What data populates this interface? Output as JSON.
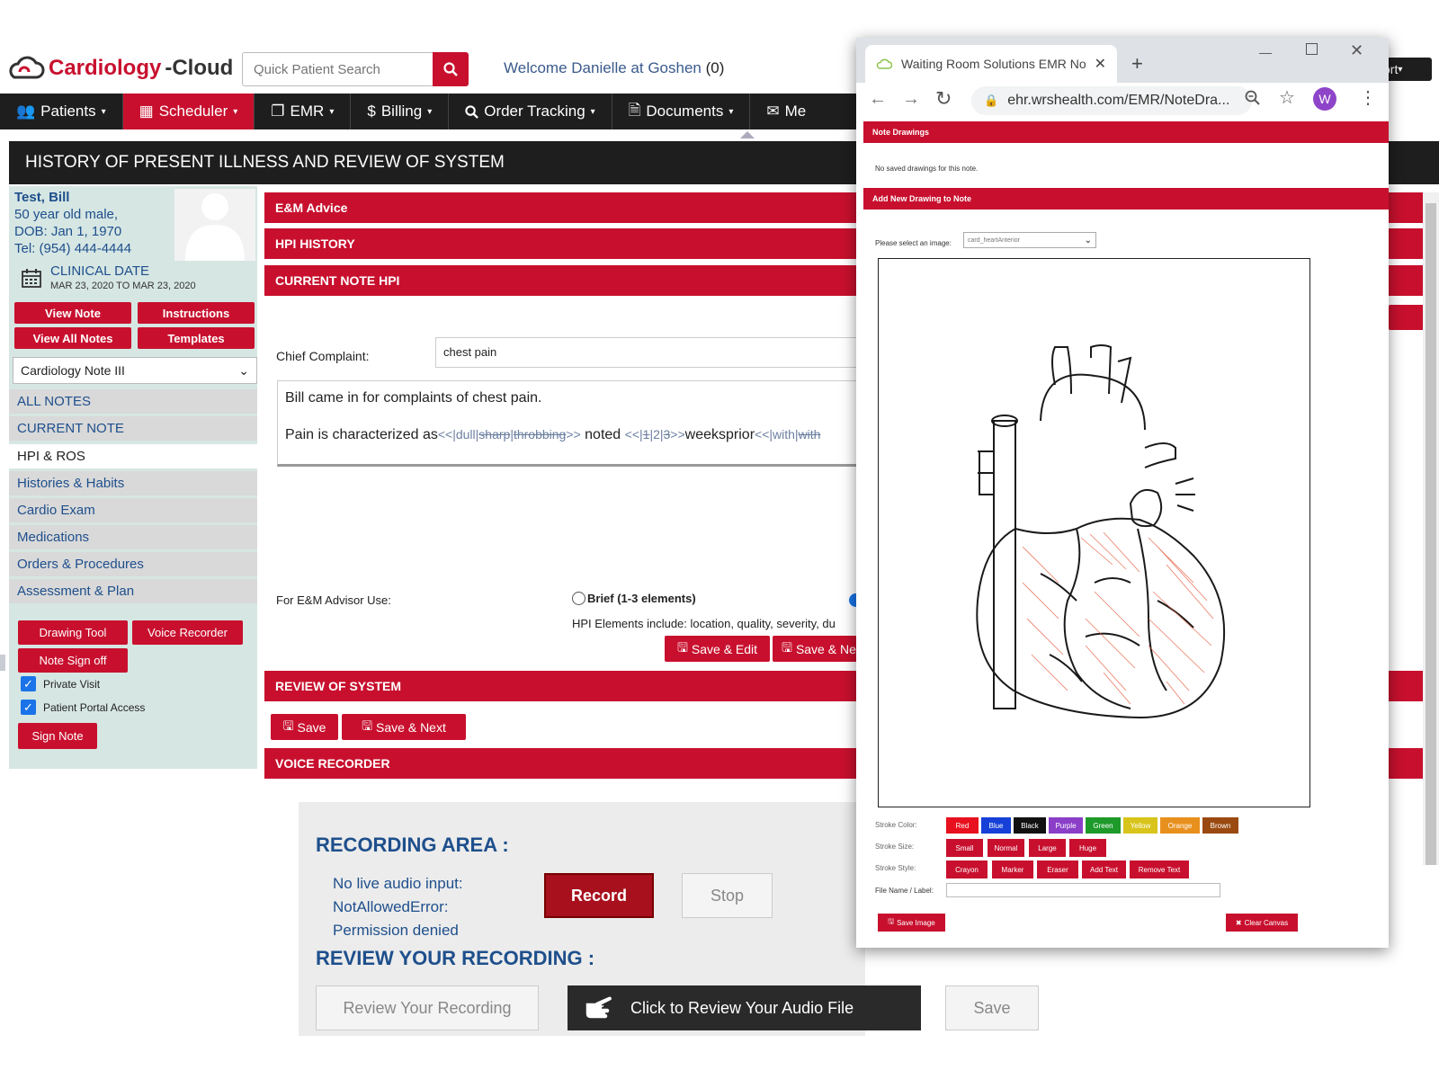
{
  "header": {
    "brand_part1": "Cardiology",
    "brand_part2": "-Cloud",
    "search_placeholder": "Quick Patient Search",
    "welcome": "Welcome Danielle at Goshen",
    "welcome_count": "(0)",
    "right_menu_fragment": "ort"
  },
  "nav": {
    "items": [
      {
        "label": "Patients"
      },
      {
        "label": "Scheduler"
      },
      {
        "label": "EMR"
      },
      {
        "label": "Billing"
      },
      {
        "label": "Order Tracking"
      },
      {
        "label": "Documents"
      },
      {
        "label": "Me"
      }
    ]
  },
  "page_title": "HISTORY OF PRESENT ILLNESS AND REVIEW OF SYSTEM",
  "patient": {
    "name": "Test, Bill",
    "age_sex": "50 year old male,",
    "dob": "DOB: Jan 1, 1970",
    "tel": "Tel: (954) 444-4444",
    "clinical_date_label": "CLINICAL DATE",
    "clinical_date_range": "MAR 23, 2020 TO MAR 23, 2020"
  },
  "sidebar": {
    "buttons": [
      "View Note",
      "Instructions",
      "View All Notes",
      "Templates"
    ],
    "note_template": "Cardiology Note III",
    "links": [
      "ALL NOTES",
      "CURRENT NOTE",
      "HPI & ROS",
      "Histories & Habits",
      "Cardio Exam",
      "Medications",
      "Orders & Procedures",
      "Assessment & Plan"
    ],
    "tool_buttons": [
      "Drawing Tool",
      "Voice Recorder",
      "Note Sign off"
    ],
    "checks": [
      "Private Visit",
      "Patient Portal Access"
    ],
    "sign_note": "Sign Note"
  },
  "main": {
    "em_advice": "E&M Advice",
    "hpi_history": "HPI HISTORY",
    "current_note_hpi": "CURRENT NOTE HPI",
    "chief_complaint_label": "Chief Complaint:",
    "chief_complaint_value": "chest pain",
    "hpi_line1": "Bill came in for complaints of chest pain.",
    "hpi_line2_prefix": "Pain is characterized as",
    "hpi_opt1": "<<|dull|",
    "hpi_opt1_strike1": "sharp",
    "hpi_opt1_sep": "|",
    "hpi_opt1_strike2": "throbbing",
    "hpi_opt1_end": ">>",
    "hpi_mid": " noted ",
    "hpi_opt2a": "<<|",
    "hpi_opt2_strike": "1",
    "hpi_opt2b": "|2|",
    "hpi_opt2_strike2": "3",
    "hpi_opt2c": ">>",
    "hpi_weeks": "weeksprior",
    "hpi_opt3": "<<|with|",
    "hpi_opt3_strike": "with",
    "em_use_label": "For E&M Advisor Use:",
    "brief_label": "Brief (1-3 elements)",
    "hpi_elements": "HPI Elements include: location, quality, severity, du",
    "save_edit": "Save & Edit",
    "save_next_partial": "Save & Ne",
    "review_of_system": "REVIEW OF SYSTEM",
    "save": "Save",
    "save_next": "Save & Next",
    "voice_recorder": "VOICE RECORDER"
  },
  "recording": {
    "area_title": "RECORDING AREA :",
    "msg1": "No live audio input:",
    "msg2": "NotAllowedError:",
    "msg3": "Permission denied",
    "record": "Record",
    "stop": "Stop",
    "review_title": "REVIEW YOUR RECORDING :",
    "review_btn": "Review Your Recording",
    "click_review": "Click to Review Your Audio File",
    "save": "Save"
  },
  "popup": {
    "tab_title": "Waiting Room Solutions EMR No",
    "url": "ehr.wrshealth.com/EMR/NoteDra...",
    "profile_initial": "W",
    "note_drawings": "Note Drawings",
    "no_saved": "No saved drawings for this note.",
    "add_new": "Add New Drawing to Note",
    "select_label": "Please select an image:",
    "select_value": "card_heartAnterior",
    "stroke_color_label": "Stroke Color:",
    "colors": [
      {
        "label": "Red",
        "hex": "#e8101e"
      },
      {
        "label": "Blue",
        "hex": "#1640d8"
      },
      {
        "label": "Black",
        "hex": "#111111"
      },
      {
        "label": "Purple",
        "hex": "#8b3fc8"
      },
      {
        "label": "Green",
        "hex": "#1e9a2a"
      },
      {
        "label": "Yellow",
        "hex": "#d8c41a"
      },
      {
        "label": "Orange",
        "hex": "#e8901e"
      },
      {
        "label": "Brown",
        "hex": "#9a4a10"
      }
    ],
    "stroke_size_label": "Stroke Size:",
    "sizes": [
      "Small",
      "Normal",
      "Large",
      "Huge"
    ],
    "stroke_style_label": "Stroke Style:",
    "styles": [
      "Crayon",
      "Marker",
      "Eraser",
      "Add Text",
      "Remove Text"
    ],
    "file_label": "File Name / Label:",
    "save_image": "Save Image",
    "clear_canvas": "Clear Canvas"
  },
  "colors": {
    "brand_red": "#c8102e",
    "nav_dark": "#1e1e1e",
    "link_blue": "#1e4f8c"
  }
}
